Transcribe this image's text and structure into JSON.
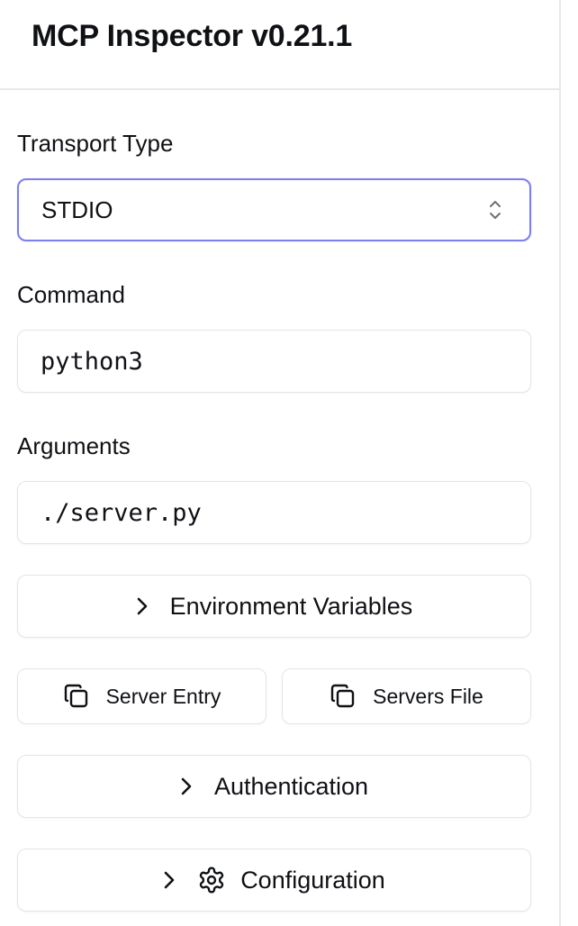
{
  "app": {
    "title": "MCP Inspector v0.21.1"
  },
  "transport": {
    "label": "Transport Type",
    "value": "STDIO"
  },
  "command": {
    "label": "Command",
    "value": "python3"
  },
  "arguments": {
    "label": "Arguments",
    "value": "./server.py"
  },
  "buttons": {
    "env_vars": "Environment Variables",
    "server_entry": "Server Entry",
    "servers_file": "Servers File",
    "authentication": "Authentication",
    "configuration": "Configuration"
  },
  "icons": {
    "select": "chevron-up-down-icon",
    "expand": "chevron-right-icon",
    "copy": "copy-icon",
    "settings": "gear-icon"
  },
  "colors": {
    "focus_border": "#7b7ff0",
    "border": "#e3e5e9",
    "text": "#0f1115"
  }
}
